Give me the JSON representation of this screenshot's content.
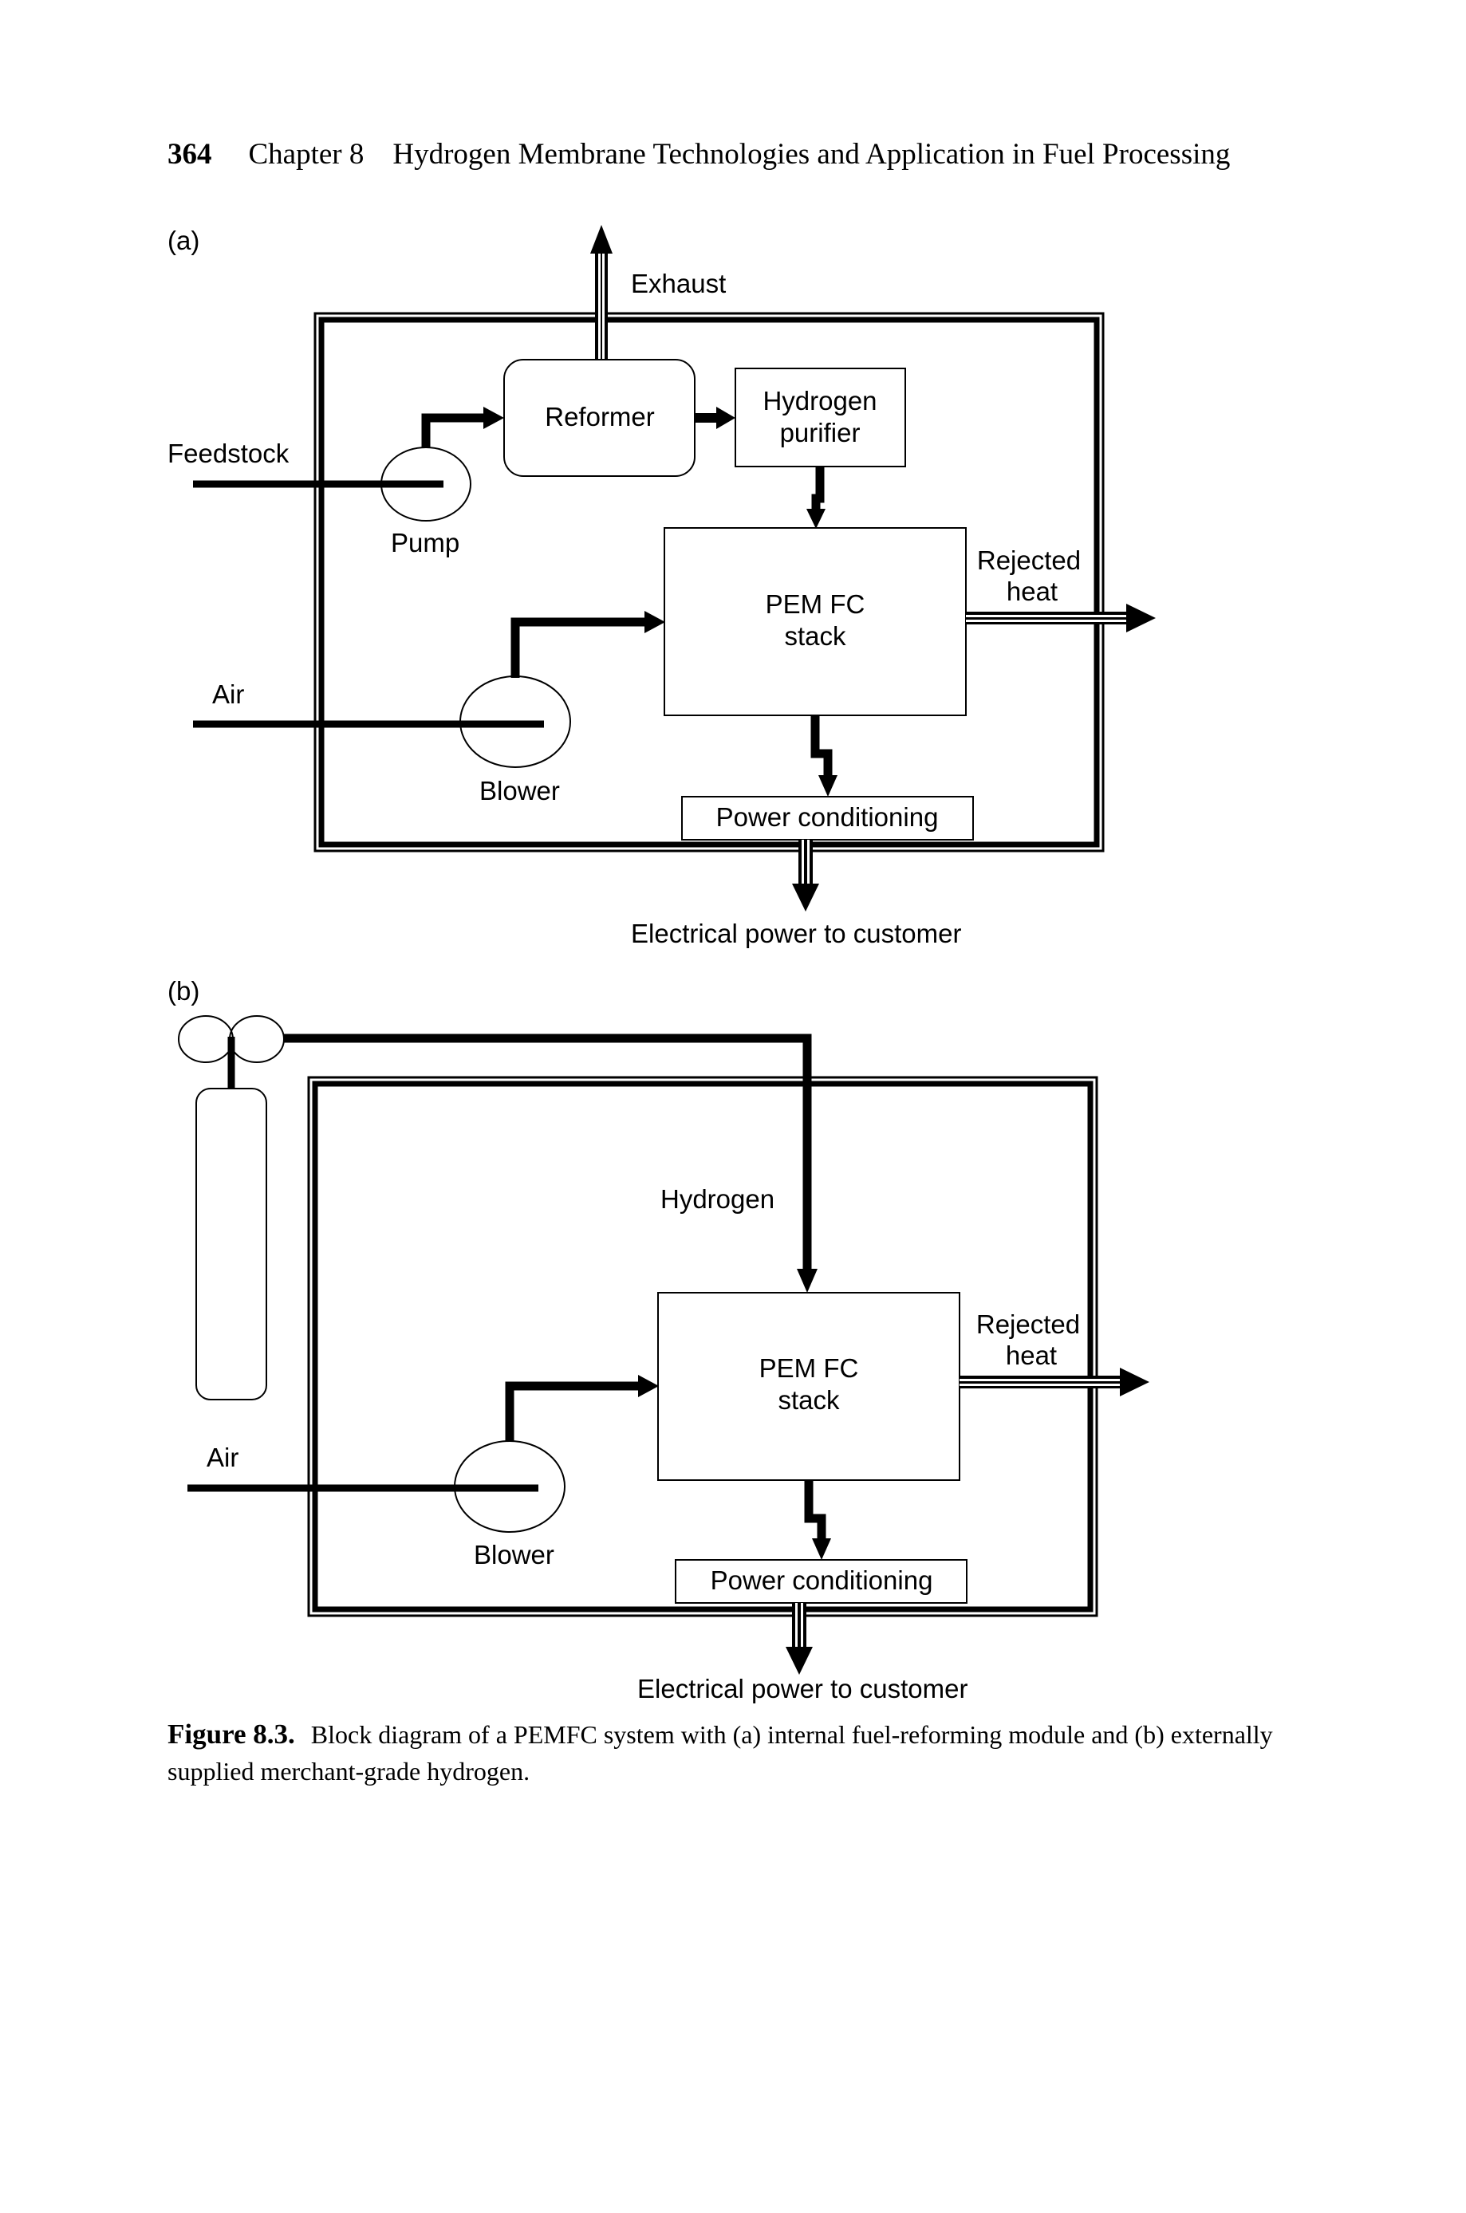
{
  "header": {
    "page_number": "364",
    "chapter": "Chapter 8",
    "title": "Hydrogen Membrane Technologies and Application in Fuel Processing"
  },
  "figure": {
    "panel_a": {
      "label": "(a)",
      "exhaust": "Exhaust",
      "feedstock": "Feedstock",
      "pump": "Pump",
      "reformer": "Reformer",
      "purifier_line1": "Hydrogen",
      "purifier_line2": "purifier",
      "stack_line1": "PEM FC",
      "stack_line2": "stack",
      "rejected_line1": "Rejected",
      "rejected_line2": "heat",
      "air": "Air",
      "blower": "Blower",
      "power_conditioning": "Power conditioning",
      "electrical_output": "Electrical power to customer"
    },
    "panel_b": {
      "label": "(b)",
      "hydrogen": "Hydrogen",
      "stack_line1": "PEM FC",
      "stack_line2": "stack",
      "rejected_line1": "Rejected",
      "rejected_line2": "heat",
      "air": "Air",
      "blower": "Blower",
      "power_conditioning": "Power conditioning",
      "electrical_output": "Electrical power to customer"
    }
  },
  "caption": {
    "label": "Figure 8.3.",
    "text": "Block diagram of a PEMFC system with (a) internal fuel-reforming module and (b) externally supplied merchant-grade hydrogen."
  }
}
